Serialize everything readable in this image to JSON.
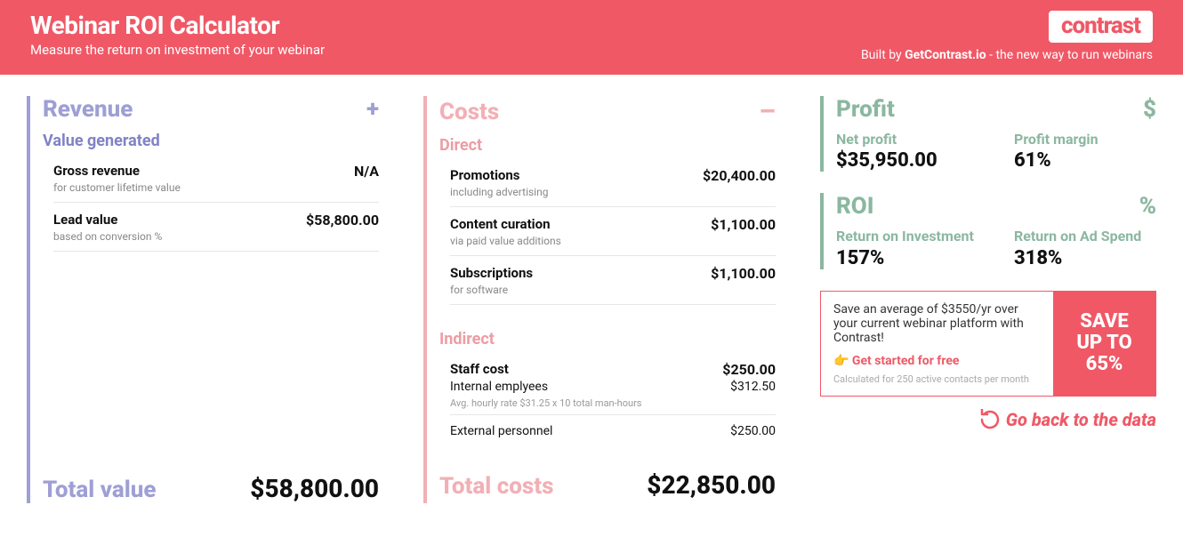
{
  "header": {
    "title": "Webinar ROI Calculator",
    "subtitle": "Measure the return on investment of your webinar",
    "logo": "contrast",
    "byline_prefix": "Built by ",
    "byline_bold": "GetContrast.io",
    "byline_suffix": " - the new way to run webinars"
  },
  "revenue": {
    "title": "Revenue",
    "section_label": "Value generated",
    "items": [
      {
        "label": "Gross revenue",
        "sub": "for customer lifetime value",
        "value": "N/A"
      },
      {
        "label": "Lead value",
        "sub": "based on conversion %",
        "value": "$58,800.00"
      }
    ],
    "total_label": "Total value",
    "total_value": "$58,800.00"
  },
  "costs": {
    "title": "Costs",
    "direct_label": "Direct",
    "direct": [
      {
        "label": "Promotions",
        "sub": "including advertising",
        "value": "$20,400.00"
      },
      {
        "label": "Content curation",
        "sub": "via paid value additions",
        "value": "$1,100.00"
      },
      {
        "label": "Subscriptions",
        "sub": "for software",
        "value": "$1,100.00"
      }
    ],
    "indirect_label": "Indirect",
    "staff_cost_label": "Staff cost",
    "staff_cost_value": "$250.00",
    "internal_label": "Internal emplyees",
    "internal_value": "$312.50",
    "internal_note": "Avg. hourly rate $31.25 x 10 total man-hours",
    "external_label": "External personnel",
    "external_value": "$250.00",
    "total_label": "Total costs",
    "total_value": "$22,850.00"
  },
  "profit": {
    "title": "Profit",
    "net_label": "Net profit",
    "net_value": "$35,950.00",
    "margin_label": "Profit margin",
    "margin_value": "61%"
  },
  "roi": {
    "title": "ROI",
    "roi_label": "Return on Investment",
    "roi_value": "157%",
    "roas_label": "Return on Ad Spend",
    "roas_value": "318%"
  },
  "promo": {
    "text": "Save an average of $3550/yr over your current webinar platform with Contrast!",
    "cta_icon": "👉",
    "cta_text": "Get started for free",
    "fineprint": "Calculated for 250 active contacts per month",
    "badge": "SAVE UP TO 65%"
  },
  "goback": "Go back to the data"
}
